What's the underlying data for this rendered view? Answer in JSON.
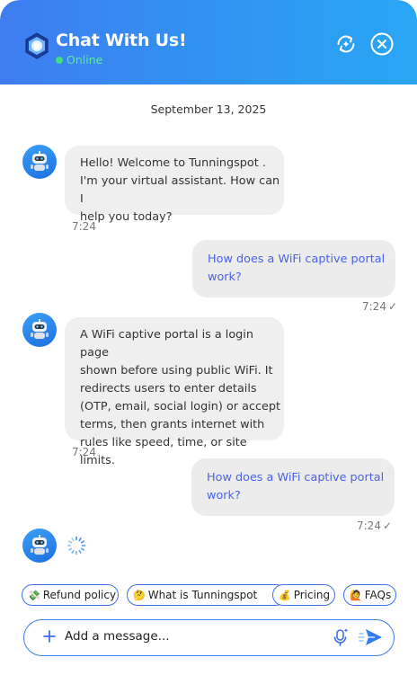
{
  "colors": {
    "header_gradient_start": "#3f7cf0",
    "header_gradient_end": "#2aa6f4",
    "online": "#3ee07f",
    "user_text": "#4a63e6",
    "accent_border": "#3f6fea"
  },
  "header": {
    "title": "Chat With Us!",
    "status": "Online",
    "logo_icon": "hexagon-logo-icon",
    "refresh_icon": "refresh-sparkle-icon",
    "close_icon": "close-circle-icon"
  },
  "date_divider": "September 13, 2025",
  "messages": [
    {
      "sender": "bot",
      "lines": [
        "Hello! Welcome to Tunningspot .",
        "I'm your virtual assistant. How can I",
        "help you today?"
      ],
      "time": "7:24"
    },
    {
      "sender": "user",
      "lines": [
        "How does a WiFi captive portal",
        "work?"
      ],
      "time": "7:24",
      "check": "✓"
    },
    {
      "sender": "bot",
      "lines": [
        "A WiFi captive portal is a login page",
        "shown before using public WiFi. It",
        "redirects users to enter details",
        "(OTP, email, social login) or accept",
        "terms, then grants internet with",
        "rules like speed, time, or site limits."
      ],
      "time": "7:24"
    },
    {
      "sender": "user",
      "lines": [
        "How does a WiFi captive portal",
        "work?"
      ],
      "time": "7:24",
      "check": "✓"
    }
  ],
  "quick_replies": [
    {
      "emoji": "💸",
      "label": "Refund policy"
    },
    {
      "emoji": "🤔",
      "label": "What is Tunningspot"
    },
    {
      "emoji": "💰",
      "label": "Pricing"
    },
    {
      "emoji": "🙋",
      "label": "FAQs"
    }
  ],
  "composer": {
    "placeholder": "Add a message...",
    "plus_icon": "plus-icon",
    "mic_icon": "mic-sparkle-icon",
    "send_icon": "send-icon"
  }
}
